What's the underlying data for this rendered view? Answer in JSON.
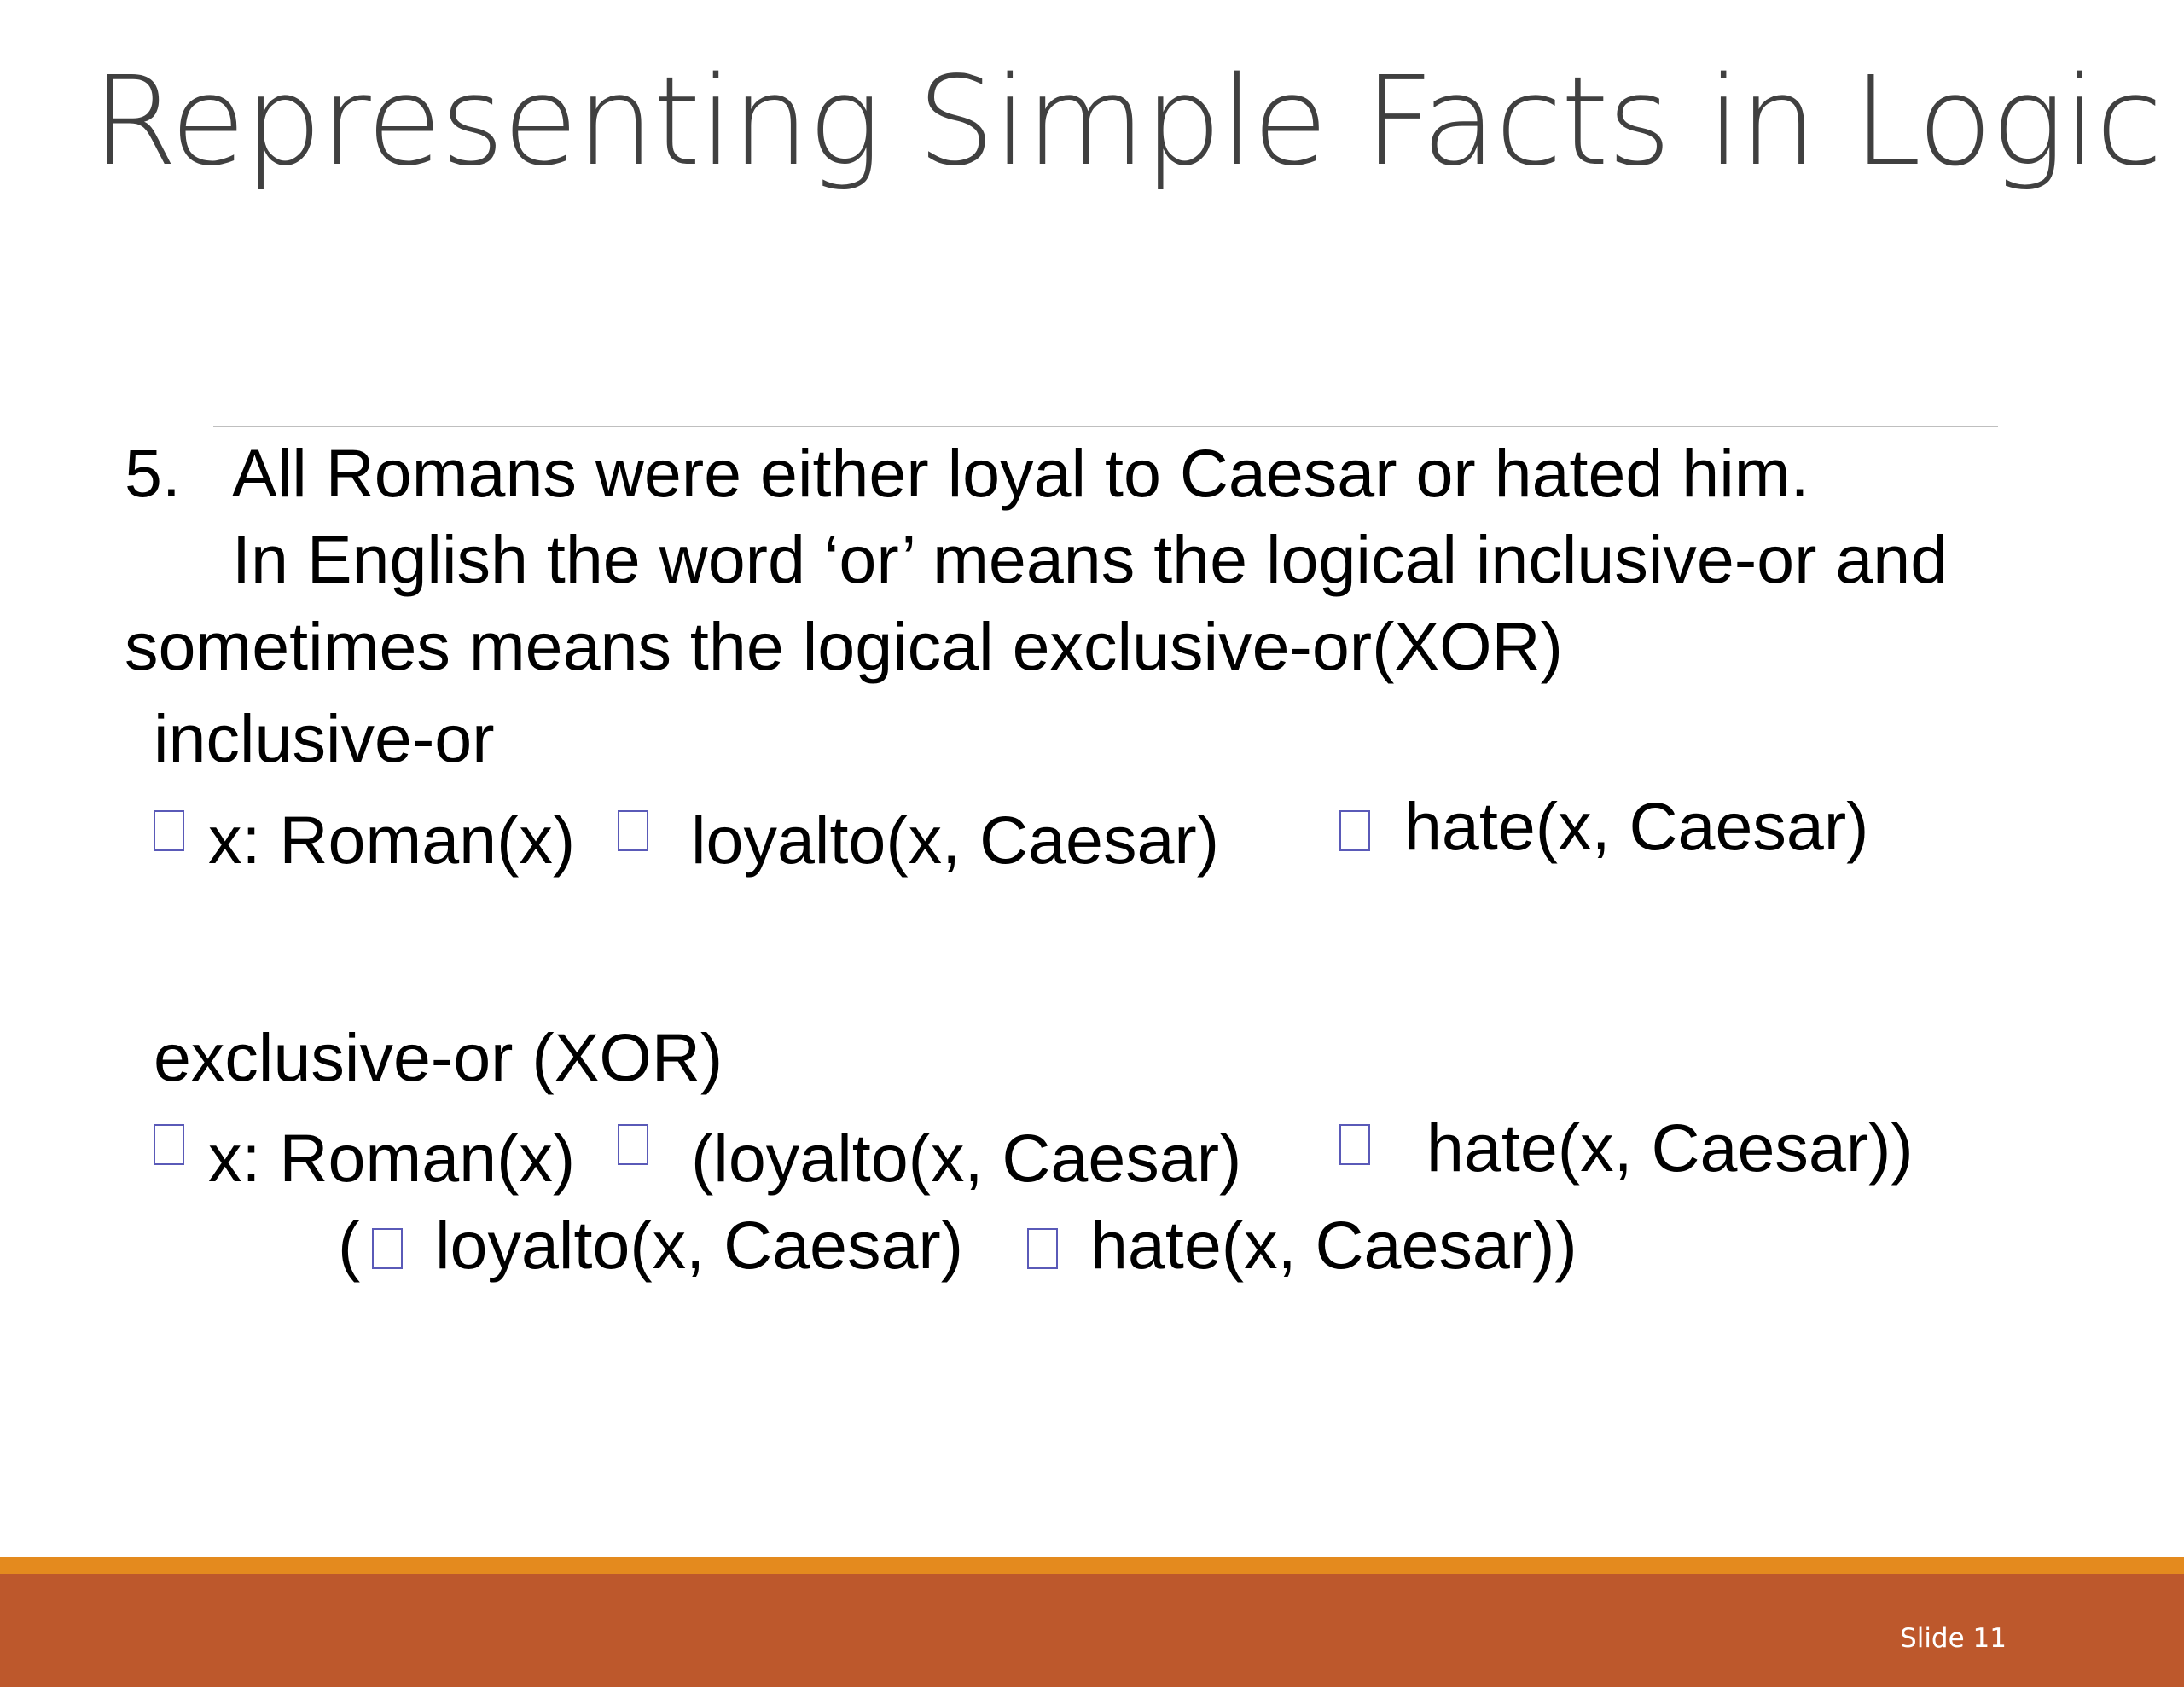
{
  "slide": {
    "title": "Representing Simple Facts in Logic",
    "statement": {
      "number": "5.",
      "text": "All Romans were either loyal to Caesar or hated him."
    },
    "explanation": {
      "line1": "In English the word ‘or’ means the logical inclusive-or and",
      "line2": "sometimes means the logical exclusive-or(XOR)"
    },
    "inclusive": {
      "heading": "inclusive-or",
      "part1": "x: Roman(x)",
      "part2": "loyalto(x, Caesar)",
      "part3": "hate(x, Caesar)"
    },
    "exclusive": {
      "heading": "exclusive-or (XOR)",
      "line1_part1": "x: Roman(x)",
      "line1_part2": "(loyalto(x, Caesar)",
      "line1_part3": "hate(x, Caesar))",
      "line2_open": "(",
      "line2_part1": "loyalto(x, Caesar)",
      "line2_part2": "hate(x, Caesar))"
    },
    "footer": {
      "slide_label": "Slide 11"
    },
    "colors": {
      "footer_band": "#bd582c",
      "footer_stripe": "#e48a1e",
      "title_text": "#404040",
      "missing_glyph_box": "#5a5ab8"
    }
  }
}
